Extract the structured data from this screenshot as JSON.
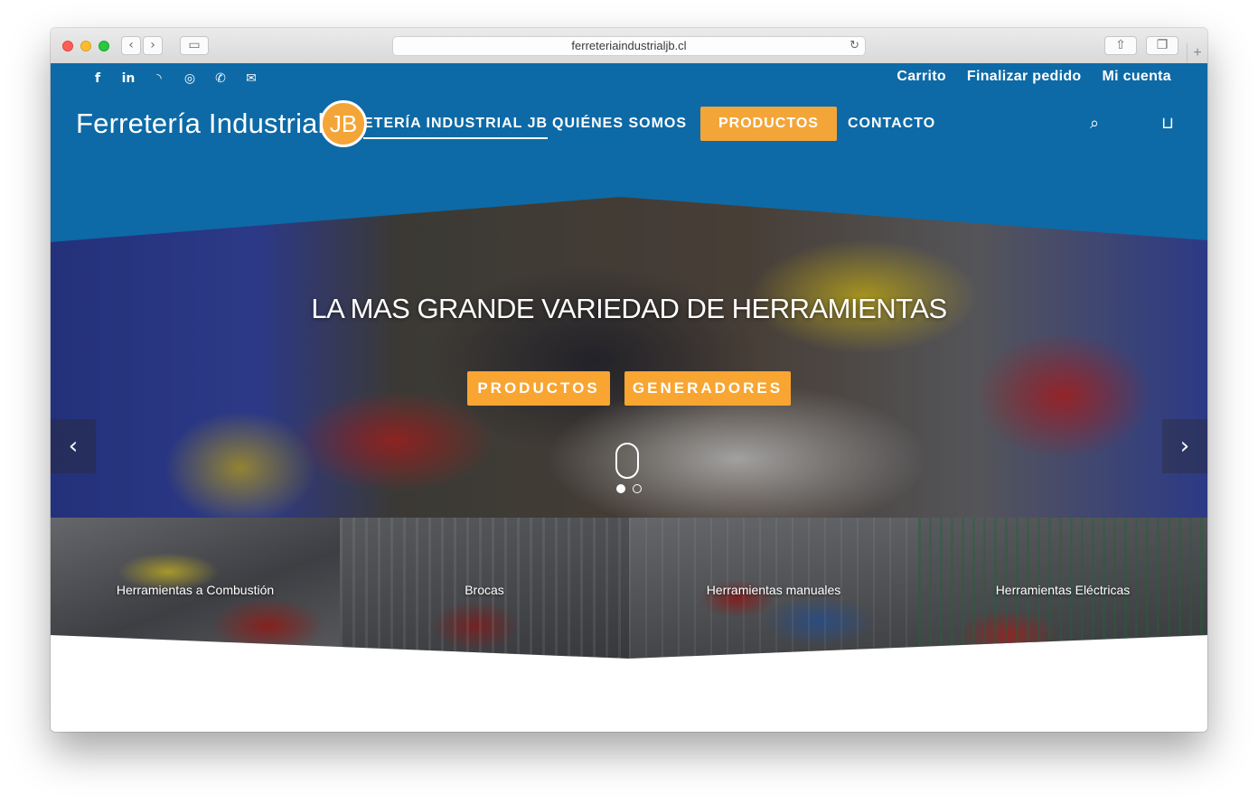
{
  "browser": {
    "url": "ferreteriaindustrialjb.cl"
  },
  "topbar": {
    "social_icons": [
      "facebook-icon",
      "linkedin-icon",
      "rss-icon",
      "instagram-icon",
      "phone-icon",
      "email-icon"
    ],
    "links": [
      "Carrito",
      "Finalizar pedido",
      "Mi cuenta"
    ]
  },
  "header": {
    "logo_text": "Ferretería Industrial",
    "logo_badge": "JB",
    "nav": [
      "FERRETERÍA INDUSTRIAL JB",
      "QUIÉNES SOMOS",
      "PRODUCTOS",
      "CONTACTO"
    ],
    "nav_visible_first": "ETERÍA INDUSTRIAL JB"
  },
  "hero": {
    "title": "LA MAS GRANDE VARIEDAD DE HERRAMIENTAS",
    "buttons": [
      "PRODUCTOS",
      "GENERADORES"
    ],
    "slides": 2,
    "active_slide": 1
  },
  "categories": [
    "Herramientas a Combustión",
    "Brocas",
    "Herramientas manuales",
    "Herramientas Eléctricas"
  ],
  "colors": {
    "brand_blue": "#0d6aa6",
    "accent_orange": "#f4a538"
  }
}
